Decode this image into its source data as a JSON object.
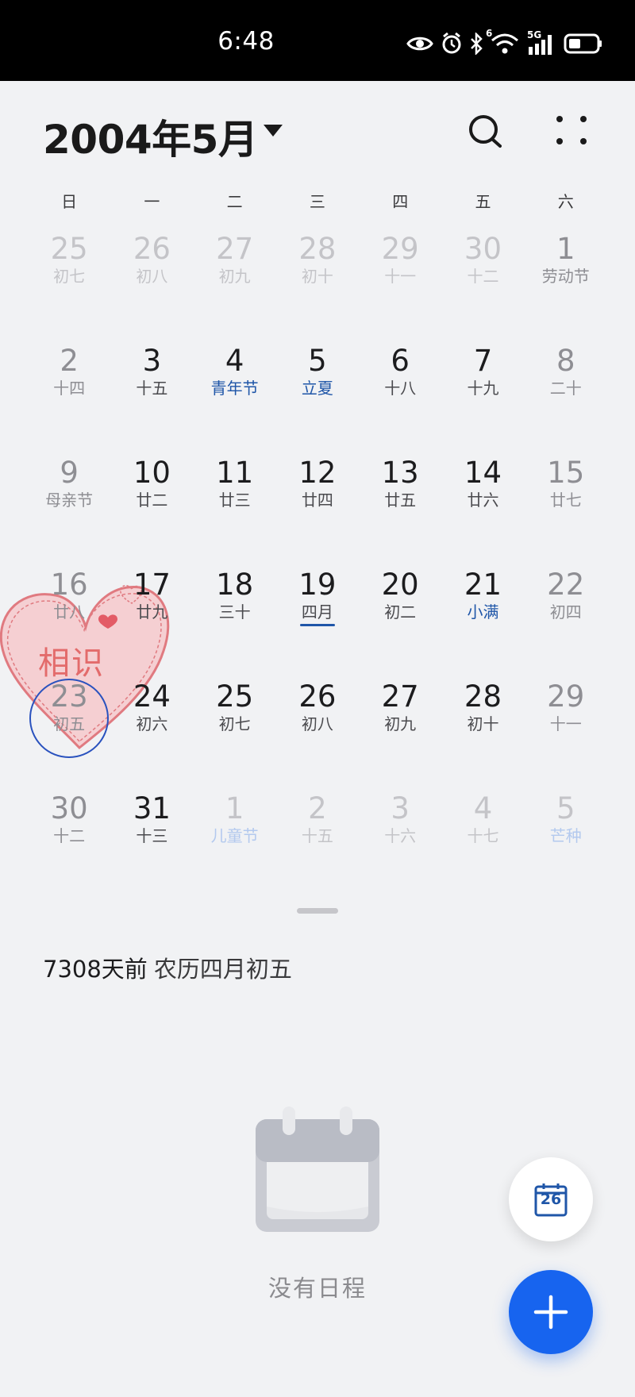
{
  "status_bar": {
    "time": "6:48",
    "icons": [
      "eye-icon",
      "alarm-icon",
      "bluetooth-icon",
      "wifi-icon",
      "5g-signal-icon",
      "battery-icon"
    ],
    "wifi_badge": "6",
    "network_label": "5G"
  },
  "header": {
    "month_title": "2004年5月",
    "actions": [
      "search-icon",
      "more-icon"
    ]
  },
  "weekdays": [
    "日",
    "一",
    "二",
    "三",
    "四",
    "五",
    "六"
  ],
  "weeks": [
    [
      {
        "day": "25",
        "sub": "初七",
        "other": true
      },
      {
        "day": "26",
        "sub": "初八",
        "other": true
      },
      {
        "day": "27",
        "sub": "初九",
        "other": true
      },
      {
        "day": "28",
        "sub": "初十",
        "other": true
      },
      {
        "day": "29",
        "sub": "十一",
        "other": true
      },
      {
        "day": "30",
        "sub": "十二",
        "other": true
      },
      {
        "day": "1",
        "sub": "劳动节",
        "holiday": true,
        "weekend": true
      }
    ],
    [
      {
        "day": "2",
        "sub": "十四",
        "weekend": true
      },
      {
        "day": "3",
        "sub": "十五"
      },
      {
        "day": "4",
        "sub": "青年节",
        "holiday": true
      },
      {
        "day": "5",
        "sub": "立夏",
        "holiday": true
      },
      {
        "day": "6",
        "sub": "十八"
      },
      {
        "day": "7",
        "sub": "十九"
      },
      {
        "day": "8",
        "sub": "二十",
        "weekend": true
      }
    ],
    [
      {
        "day": "9",
        "sub": "母亲节",
        "holiday": true,
        "weekend": true
      },
      {
        "day": "10",
        "sub": "廿二"
      },
      {
        "day": "11",
        "sub": "廿三"
      },
      {
        "day": "12",
        "sub": "廿四"
      },
      {
        "day": "13",
        "sub": "廿五"
      },
      {
        "day": "14",
        "sub": "廿六"
      },
      {
        "day": "15",
        "sub": "廿七",
        "weekend": true
      }
    ],
    [
      {
        "day": "16",
        "sub": "廿八",
        "weekend": true
      },
      {
        "day": "17",
        "sub": "廿九"
      },
      {
        "day": "18",
        "sub": "三十"
      },
      {
        "day": "19",
        "sub": "四月",
        "today_underline": true
      },
      {
        "day": "20",
        "sub": "初二"
      },
      {
        "day": "21",
        "sub": "小满",
        "holiday": true
      },
      {
        "day": "22",
        "sub": "初四",
        "weekend": true
      }
    ],
    [
      {
        "day": "23",
        "sub": "初五",
        "weekend": true,
        "selected": true
      },
      {
        "day": "24",
        "sub": "初六"
      },
      {
        "day": "25",
        "sub": "初七"
      },
      {
        "day": "26",
        "sub": "初八"
      },
      {
        "day": "27",
        "sub": "初九"
      },
      {
        "day": "28",
        "sub": "初十"
      },
      {
        "day": "29",
        "sub": "十一",
        "weekend": true
      }
    ],
    [
      {
        "day": "30",
        "sub": "十二",
        "weekend": true
      },
      {
        "day": "31",
        "sub": "十三"
      },
      {
        "day": "1",
        "sub": "儿童节",
        "other": true,
        "holiday": true
      },
      {
        "day": "2",
        "sub": "十五",
        "other": true
      },
      {
        "day": "3",
        "sub": "十六",
        "other": true
      },
      {
        "day": "4",
        "sub": "十七",
        "other": true
      },
      {
        "day": "5",
        "sub": "芒种",
        "other": true,
        "holiday": true
      }
    ]
  ],
  "sticker": {
    "text": "相识",
    "shape": "heart-sticker"
  },
  "info": {
    "days_ago": "7308天前",
    "lunar_date": "农历四月初五"
  },
  "empty_state": {
    "icon": "calendar-empty-icon",
    "text": "没有日程"
  },
  "fabs": {
    "today_day": "26",
    "today_icon": "calendar-today-icon",
    "add_icon": "plus-icon"
  },
  "colors": {
    "accent": "#1764ef",
    "holiday": "#1f56a8",
    "sticker": "#e36b6b",
    "background": "#f1f2f4"
  }
}
